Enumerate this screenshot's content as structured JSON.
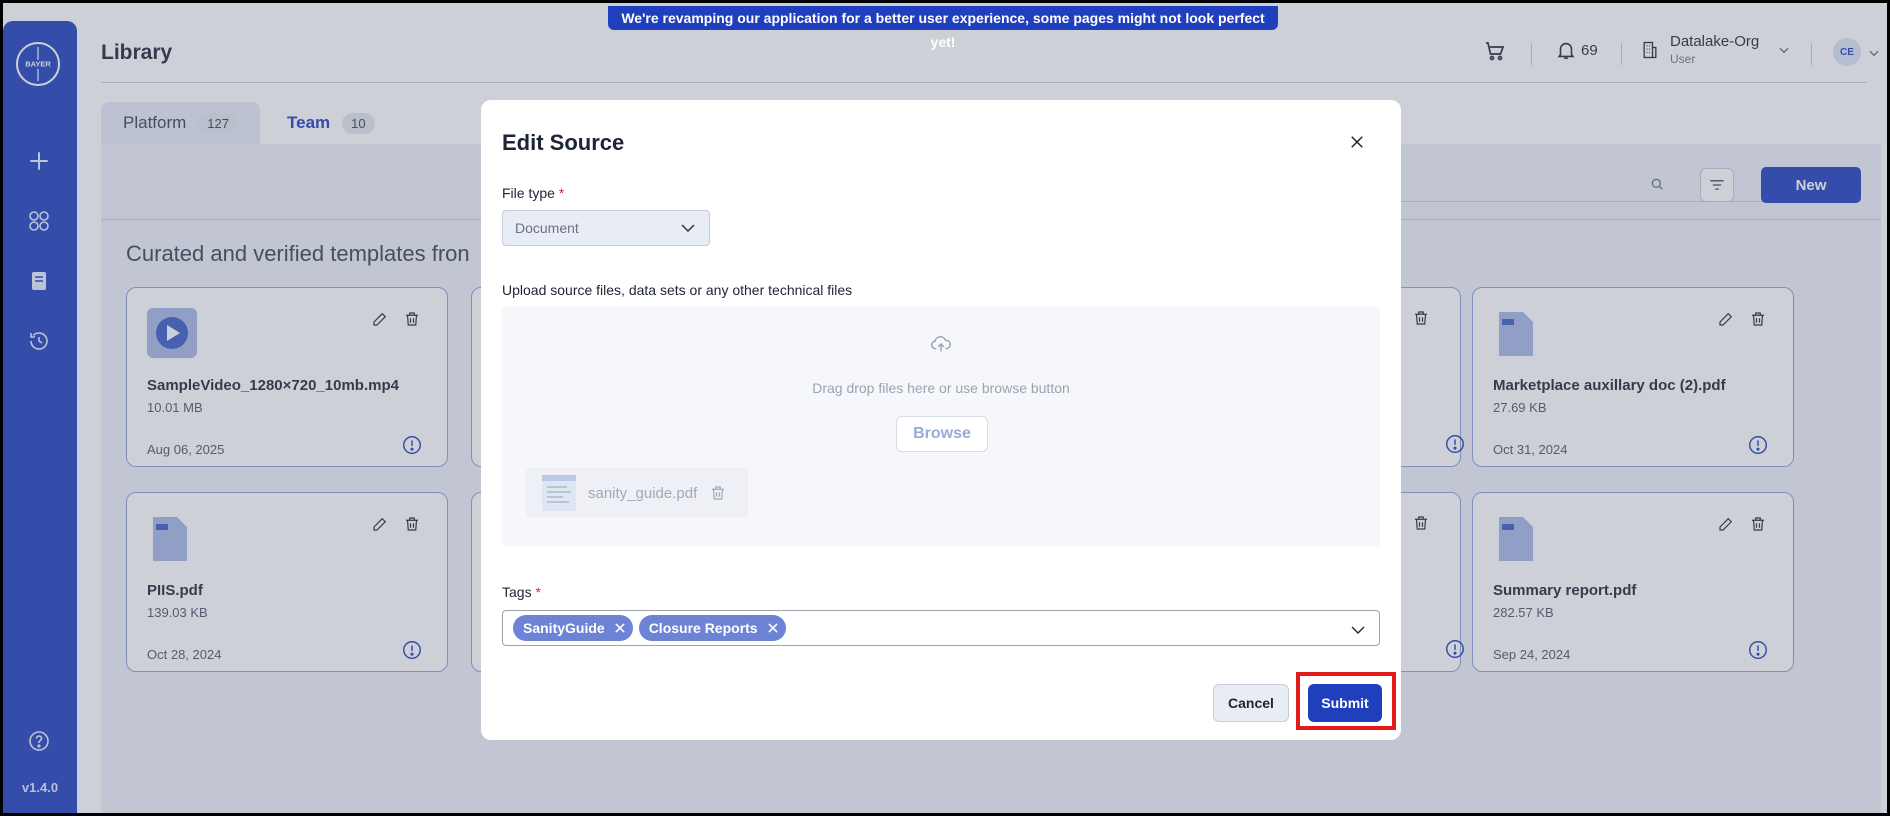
{
  "banner": "We're revamping our application for a better user experience, some pages might not look perfect yet!",
  "sidebar": {
    "logo_text": "BAYER",
    "version": "v1.4.0"
  },
  "header": {
    "title": "Library",
    "notifications": "69",
    "org_name": "Datalake-Org",
    "org_role": "User",
    "avatar": "CE"
  },
  "tabs": [
    {
      "label": "Platform",
      "count": "127"
    },
    {
      "label": "Team",
      "count": "10"
    }
  ],
  "toolbar": {
    "new_label": "New"
  },
  "section_title": "Curated and verified templates fron",
  "cards": [
    {
      "name": "SampleVideo_1280×720_10mb.mp4",
      "size": "10.01 MB",
      "date": "Aug 06, 2025"
    },
    {
      "name": "Marketplace auxillary doc (2).pdf",
      "size": "27.69 KB",
      "date": "Oct 31, 2024"
    },
    {
      "name": "PIIS.pdf",
      "size": "139.03 KB",
      "date": "Oct 28, 2024"
    },
    {
      "name": "Summary report.pdf",
      "size": "282.57 KB",
      "date": "Sep 24, 2024"
    }
  ],
  "modal": {
    "title": "Edit Source",
    "file_type_label": "File type",
    "required_mark": "*",
    "file_type_value": "Document",
    "upload_label": "Upload source files, data sets or any other technical files",
    "dropzone_text": "Drag drop files here or use browse button",
    "browse_label": "Browse",
    "file_name": "sanity_guide.pdf",
    "tags_label": "Tags",
    "tags": [
      "SanityGuide",
      "Closure Reports"
    ],
    "cancel_label": "Cancel",
    "submit_label": "Submit"
  }
}
